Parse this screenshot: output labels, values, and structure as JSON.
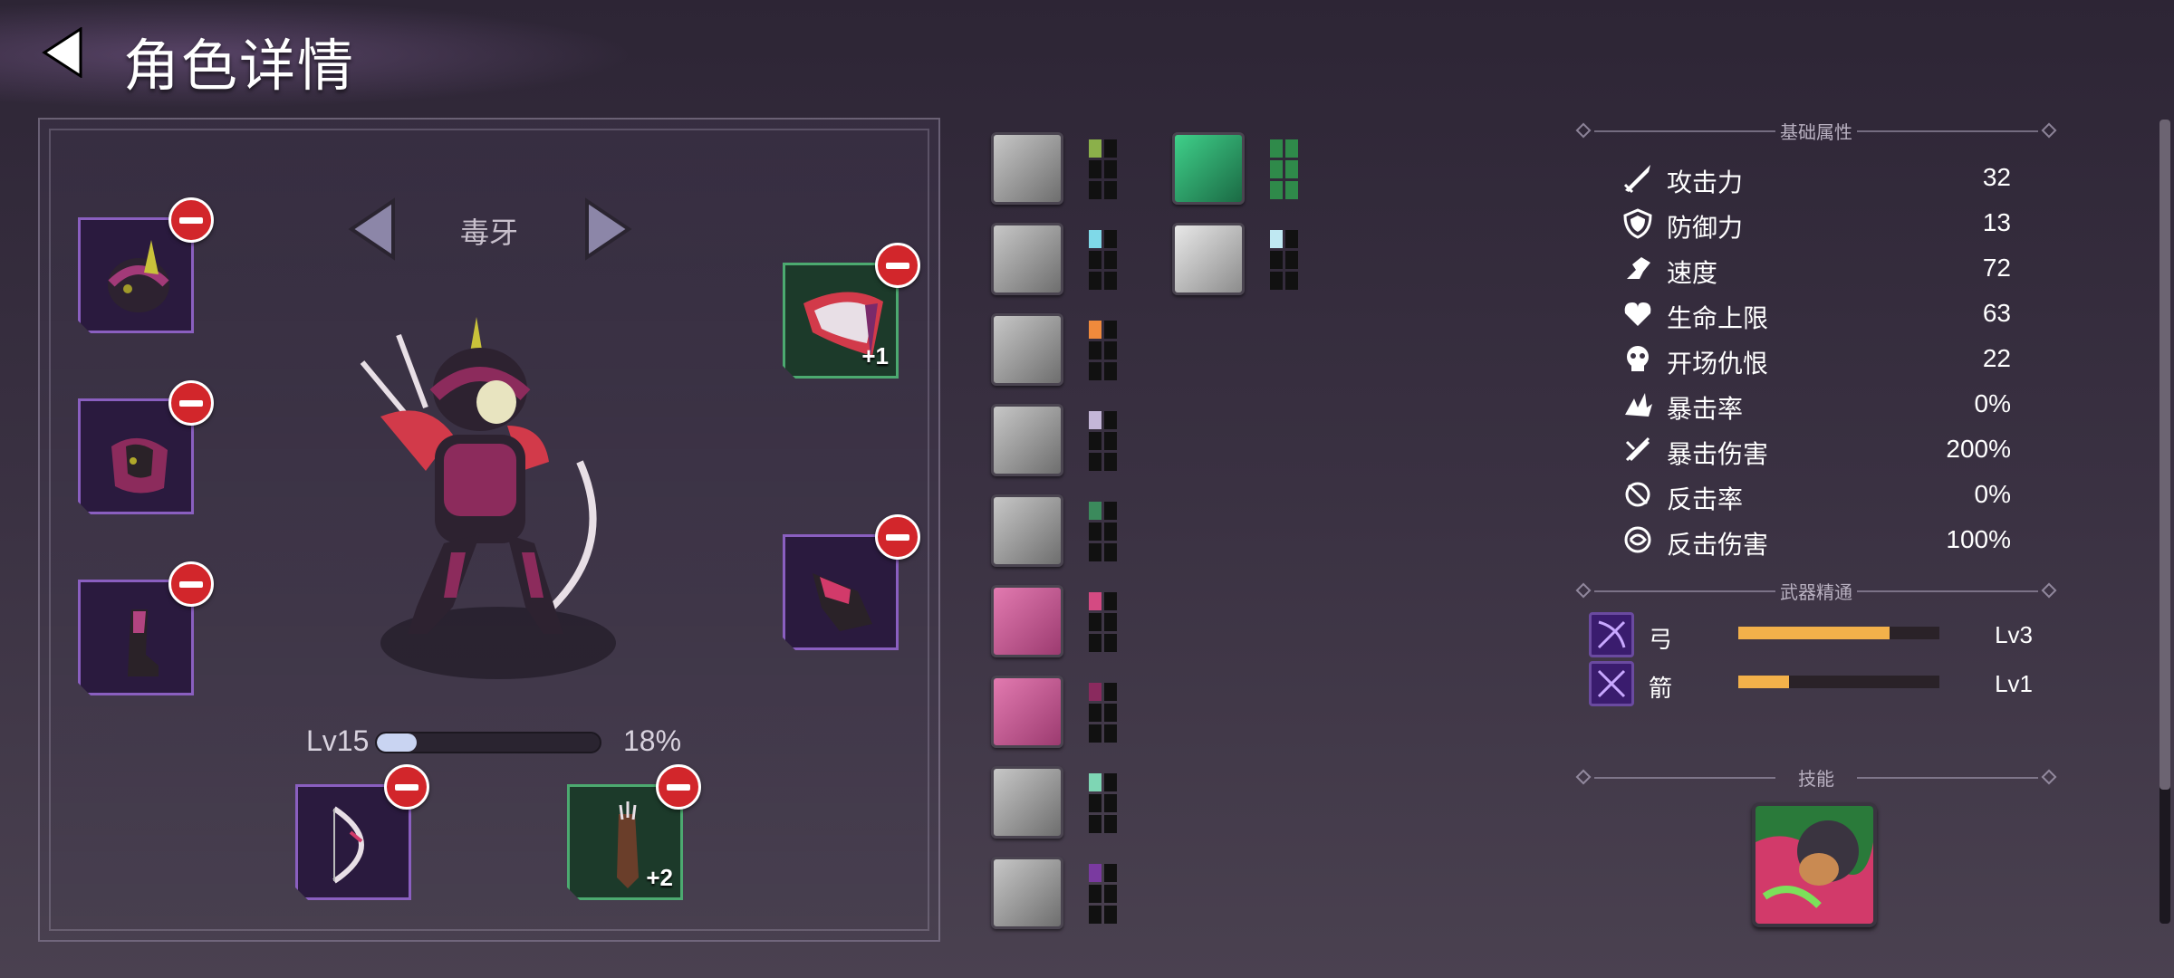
{
  "header": {
    "title": "角色详情"
  },
  "character": {
    "name": "毒牙",
    "level_label": "Lv15",
    "xp_percent_label": "18%",
    "xp_fraction": 0.18
  },
  "equipment": {
    "left_slots": [
      {
        "item": "helmet-icon"
      },
      {
        "item": "chest-armor-icon"
      },
      {
        "item": "boot-icon"
      }
    ],
    "right_slots": [
      {
        "item": "shoulder-guard-icon",
        "bonus": "+1"
      },
      {
        "item": "gauntlet-icon",
        "bonus": ""
      }
    ],
    "bottom_slots": [
      {
        "item": "bow-icon",
        "bonus": ""
      },
      {
        "item": "quiver-icon",
        "bonus": "+2"
      }
    ]
  },
  "talents": {
    "pip_colors": [
      "#8bb04a",
      "#7fd9e8",
      "#f08a3c",
      "#c4b7d8",
      "#3b8a5c",
      "#d44a82",
      "#8a2a5e",
      "#7ed6b4",
      "#7a3aa0"
    ],
    "right_pip_colors": [
      "#2f8a4a",
      "#bfe8f2"
    ]
  },
  "stats": {
    "section_title": "基础属性",
    "rows": [
      {
        "icon": "sword-icon",
        "name": "攻击力",
        "value": "32"
      },
      {
        "icon": "shield-icon",
        "name": "防御力",
        "value": "13"
      },
      {
        "icon": "boot-speed-icon",
        "name": "速度",
        "value": "72"
      },
      {
        "icon": "heart-icon",
        "name": "生命上限",
        "value": "63"
      },
      {
        "icon": "skull-icon",
        "name": "开场仇恨",
        "value": "22"
      },
      {
        "icon": "crit-burst-icon",
        "name": "暴击率",
        "value": "0%"
      },
      {
        "icon": "crit-damage-icon",
        "name": "暴击伤害",
        "value": "200%"
      },
      {
        "icon": "counter-icon",
        "name": "反击率",
        "value": "0%"
      },
      {
        "icon": "counter-damage-icon",
        "name": "反击伤害",
        "value": "100%"
      }
    ]
  },
  "mastery": {
    "section_title": "武器精通",
    "rows": [
      {
        "icon": "bow-mastery-icon",
        "name": "弓",
        "level": "Lv3",
        "fraction": 0.75
      },
      {
        "icon": "arrow-mastery-icon",
        "name": "箭",
        "level": "Lv1",
        "fraction": 0.25
      }
    ]
  },
  "skills": {
    "section_title": "技能"
  },
  "colors": {
    "slot_purple": "#8a5fc0",
    "slot_green": "#4caa70",
    "remove_red": "#d2262b",
    "mastery_orange": "#f3b14a",
    "xp_fill": "#c9d4f2"
  }
}
